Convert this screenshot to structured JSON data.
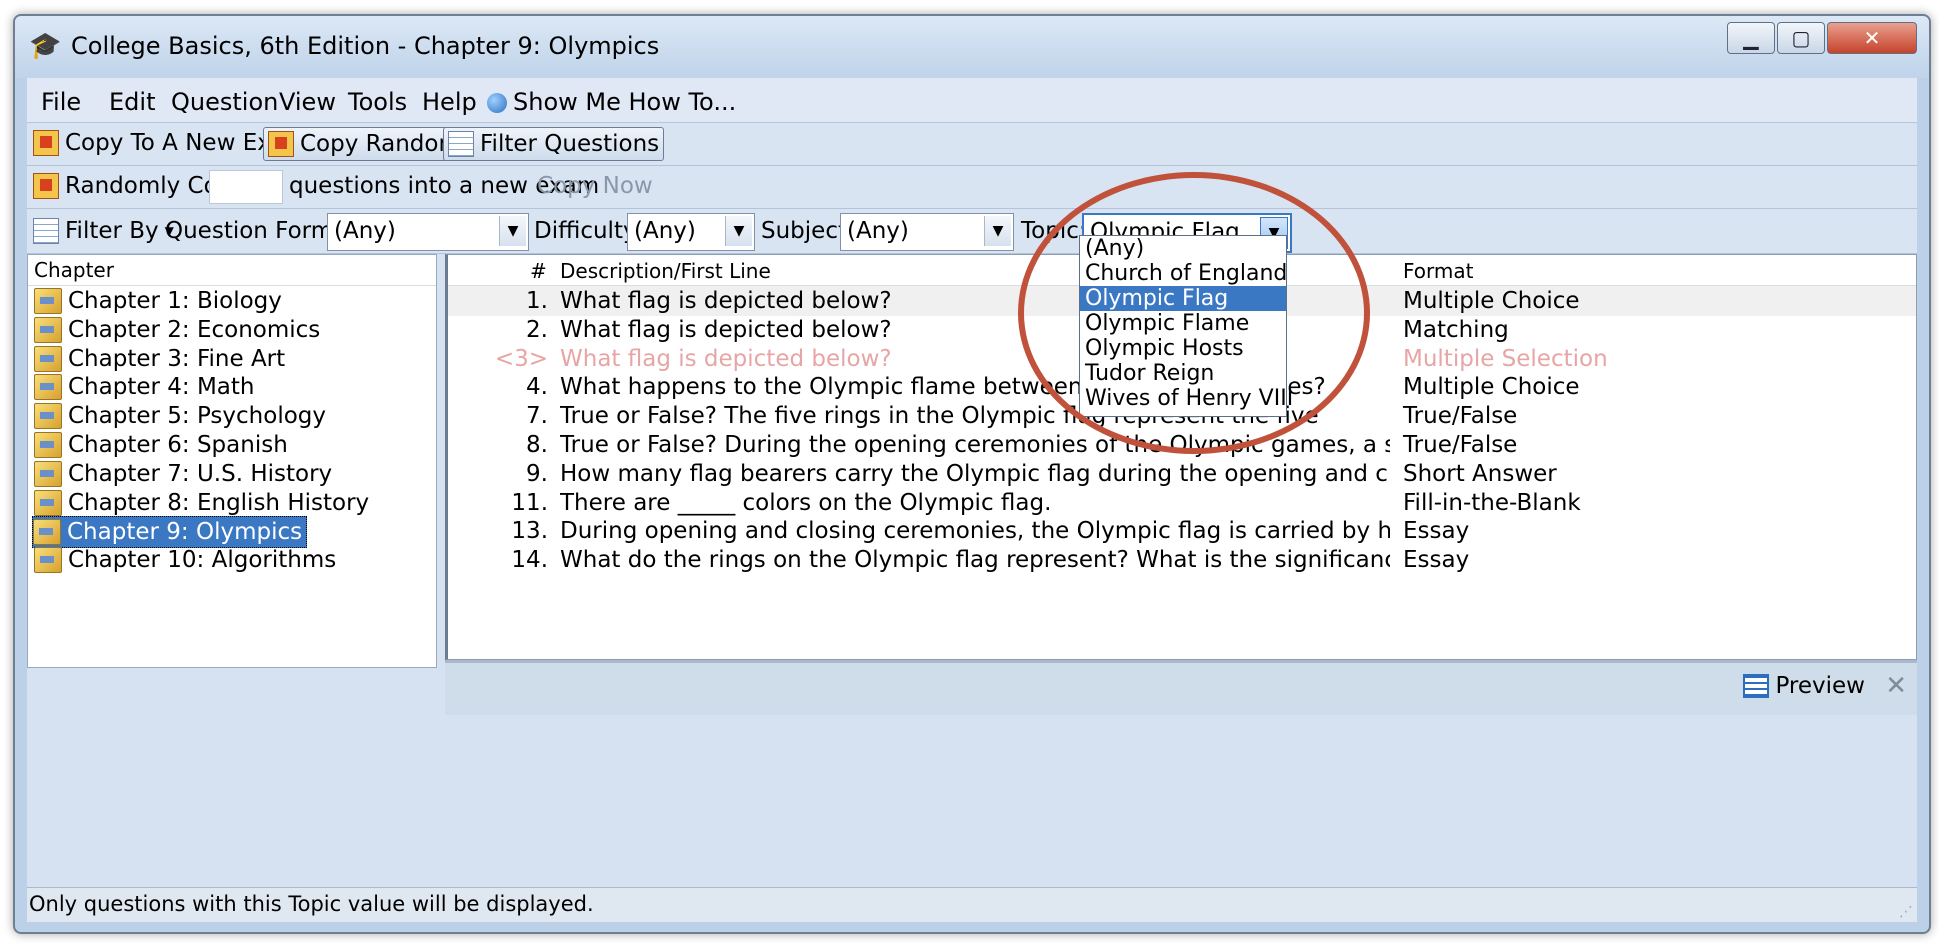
{
  "window": {
    "title": "College Basics, 6th Edition - Chapter 9: Olympics"
  },
  "menu": [
    "File",
    "Edit",
    "Question",
    "View",
    "Tools",
    "Help",
    "Show Me How To..."
  ],
  "toolbar": {
    "copy_new": "Copy To A New Exam",
    "copy_random": "Copy Randomly",
    "filter": "Filter Questions"
  },
  "random_bar": {
    "label": "Randomly Copy",
    "count_value": "",
    "suffix": "questions into a new exam",
    "copy_now": "Copy Now"
  },
  "filter_bar": {
    "filter_by": "Filter By",
    "format_label": "Question Format:",
    "format_value": "(Any)",
    "difficulty_label": "Difficulty:",
    "difficulty_value": "(Any)",
    "subject_label": "Subject:",
    "subject_value": "(Any)",
    "topic_label": "Topic:",
    "topic_value": "Olympic Flag"
  },
  "topic_options": [
    "(Any)",
    "Church of England",
    "Olympic Flag",
    "Olympic Flame",
    "Olympic Hosts",
    "Tudor Reign",
    "Wives of Henry VIII"
  ],
  "topic_selected": "Olympic Flag",
  "chapters": {
    "header": "Chapter",
    "items": [
      "Chapter 1: Biology",
      "Chapter 2: Economics",
      "Chapter 3: Fine Art",
      "Chapter 4: Math",
      "Chapter 5: Psychology",
      "Chapter 6: Spanish",
      "Chapter 7: U.S. History",
      "Chapter 8: English History",
      "Chapter 9: Olympics",
      "Chapter 10: Algorithms"
    ],
    "selected": "Chapter 9: Olympics"
  },
  "questions": {
    "headers": {
      "num": "#",
      "desc": "Description/First Line",
      "format": "Format"
    },
    "rows": [
      {
        "num": "1.",
        "desc": "What flag is depicted below?",
        "format": "Multiple Choice"
      },
      {
        "num": "2.",
        "desc": "What flag is depicted below?",
        "format": "Matching"
      },
      {
        "num": "<3>",
        "desc": "What flag is depicted below?",
        "format": "Multiple Selection"
      },
      {
        "num": "4.",
        "desc": "What happens to the Olympic flame between the Olympic games?",
        "format": "Multiple Choice"
      },
      {
        "num": "7.",
        "desc": "True or False?  The five rings in the Olympic flag represent the five",
        "format": "True/False"
      },
      {
        "num": "8.",
        "desc": "True or False?  During the opening ceremonies of the Olympic games, a single flag-bear...",
        "format": "True/False"
      },
      {
        "num": "9.",
        "desc": "How many flag bearers carry the Olympic flag during the opening and closing ceremonie...",
        "format": "Short Answer"
      },
      {
        "num": "11.",
        "desc": "There are _____ colors on the Olympic flag.",
        "format": "Fill-in-the-Blank"
      },
      {
        "num": "13.",
        "desc": "During opening and closing ceremonies, the Olympic flag is carried by hand.  How many...",
        "format": "Essay"
      },
      {
        "num": "14.",
        "desc": "What do the rings on the Olympic flag represent?  What is the significance of their color?",
        "format": "Essay"
      }
    ]
  },
  "preview": {
    "label": "Preview"
  },
  "status": {
    "text": "Only questions with this Topic value will be displayed."
  },
  "colors": {
    "selection": "#3a78c3",
    "annotation_circle": "#c0513a",
    "dimmed_row": "#e7a5a5"
  }
}
